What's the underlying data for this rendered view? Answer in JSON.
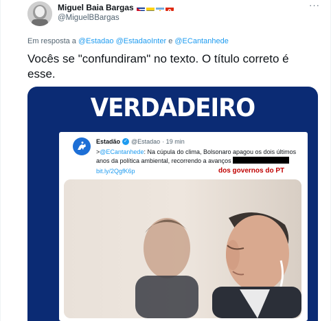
{
  "author": {
    "display_name": "Miguel Baia Bargas",
    "handle": "@MiguelBBargas",
    "flags": [
      "cuba-flag",
      "colombia-flag",
      "argentina-flag",
      "hongkong-flag"
    ]
  },
  "reply": {
    "prefix": "Em resposta a",
    "mentions": [
      "@Estadao",
      "@EstadaoInter"
    ],
    "conjunction": "e",
    "last_mention": "@ECantanhede"
  },
  "tweet": {
    "text": "Vocês se \"confundiram\" no texto. O título correto é esse."
  },
  "media": {
    "banner": "VERDADEIRO",
    "embedded_tweet": {
      "name": "Estadão",
      "handle": "@Estadao",
      "time": "· 19 min",
      "reply_prefix": ">",
      "mention": "@ECantanhede",
      "text": ": Na cúpula do clima, Bolsonaro apagou os dois últimos anos da política ambiental, recorrendo a avanços",
      "link": "bit.ly/2QgfK6p",
      "overlay_label": "dos governos do PT"
    }
  },
  "colors": {
    "link": "#1d9bf0",
    "banner_bg": "#0b2b74",
    "overlay_red": "#c00000",
    "secondary_text": "#536471"
  }
}
